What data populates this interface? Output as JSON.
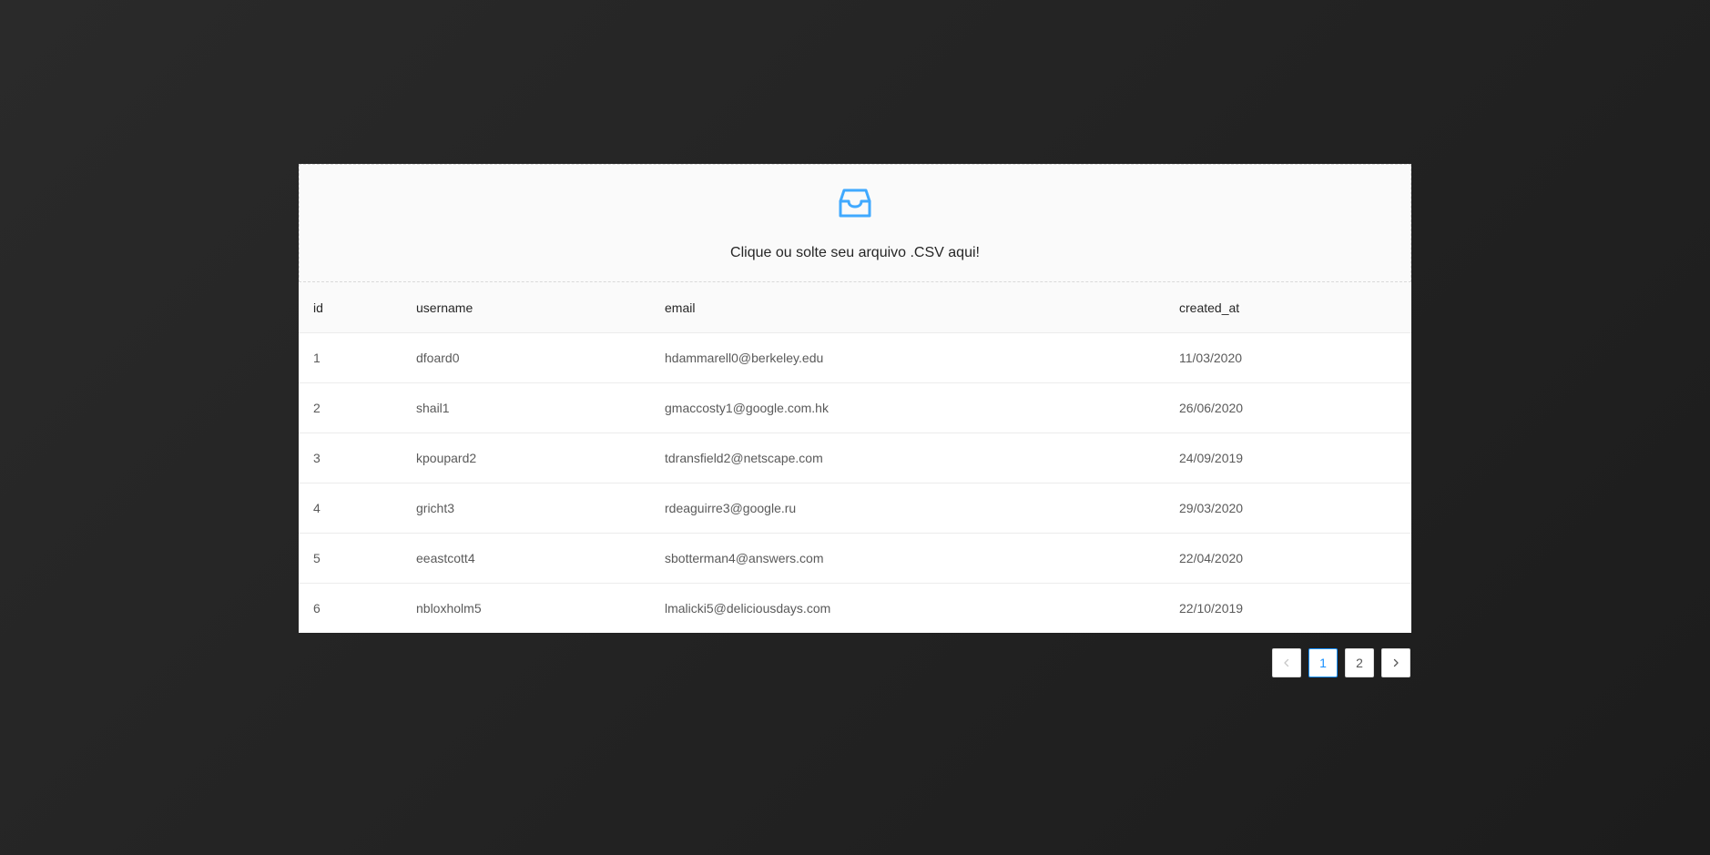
{
  "upload": {
    "icon": "inbox-icon",
    "text": "Clique ou solte seu arquivo .CSV aqui!",
    "accent_color": "#40a9ff"
  },
  "table": {
    "columns": [
      "id",
      "username",
      "email",
      "created_at"
    ],
    "rows": [
      [
        "1",
        "dfoard0",
        "hdammarell0@berkeley.edu",
        "11/03/2020"
      ],
      [
        "2",
        "shail1",
        "gmaccosty1@google.com.hk",
        "26/06/2020"
      ],
      [
        "3",
        "kpoupard2",
        "tdransfield2@netscape.com",
        "24/09/2019"
      ],
      [
        "4",
        "gricht3",
        "rdeaguirre3@google.ru",
        "29/03/2020"
      ],
      [
        "5",
        "eeastcott4",
        "sbotterman4@answers.com",
        "22/04/2020"
      ],
      [
        "6",
        "nbloxholm5",
        "lmalicki5@deliciousdays.com",
        "22/10/2019"
      ]
    ]
  },
  "pagination": {
    "prev_icon": "chevron-left-icon",
    "next_icon": "chevron-right-icon",
    "pages": [
      "1",
      "2"
    ],
    "current_page": "1",
    "active_color": "#1890ff"
  }
}
